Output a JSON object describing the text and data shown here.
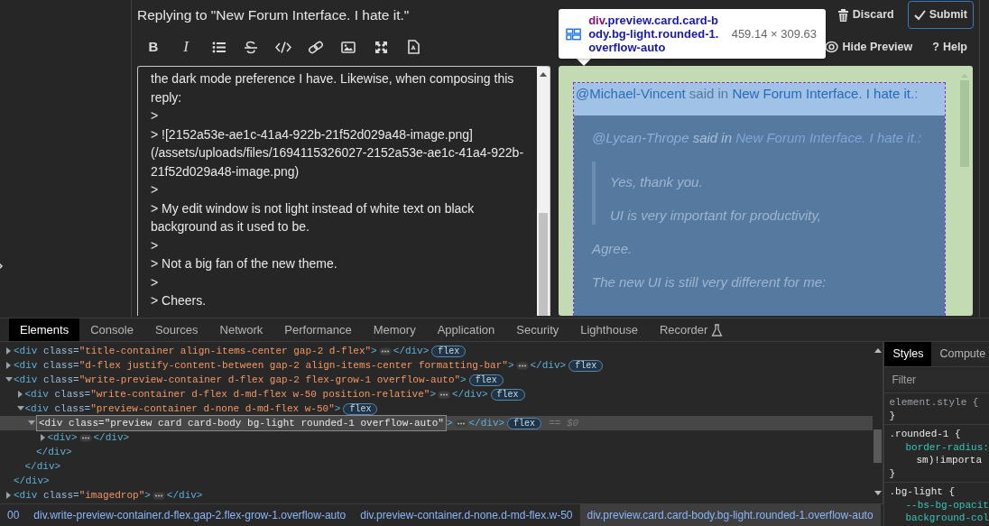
{
  "composer": {
    "title": "Replying to \"New Forum Interface. I hate it.\"",
    "actions": [
      {
        "kind": "discard",
        "label": "Discard"
      },
      {
        "kind": "submit",
        "label": "Submit"
      }
    ],
    "formatting_bar": {
      "bold_glyph": "B",
      "italic_glyph": "I"
    },
    "view_actions": [
      {
        "kind": "preview",
        "label": "Hide Preview"
      },
      {
        "kind": "help",
        "glyph": "?",
        "label": "Help"
      }
    ],
    "editor_lines": [
      "the dark mode preference I have.  Likewise, when composing this",
      "reply:",
      ">",
      "> ![2152a53e-ae1c-41a4-922b-21f52d029a48-image.png]",
      "(/assets/uploads/files/1694115326027-2152a53e-ae1c-41a4-922b-",
      "21f52d029a48-image.png)",
      ">",
      "> My edit window is not light instead of white text on black",
      "background as it used to be.",
      ">",
      "> Not a big fan of the new theme.",
      ">",
      "> Cheers."
    ],
    "preview": {
      "header": {
        "user": "@Michael-Vincent",
        "connector": "said in",
        "topic": "New Forum Interface. I hate it.",
        "suffix": ":"
      },
      "quote_header": {
        "user": "@Lycan-Thrope",
        "connector": "said in",
        "topic": "New Forum Interface. I hate it.:"
      },
      "nested_quote": [
        "Yes, thank you.",
        "UI is very important for productivity,"
      ],
      "paragraphs": [
        "Agree.",
        "The new UI is still very different for me:"
      ]
    }
  },
  "tooltip": {
    "tag": "div",
    "classes": ".preview.card.card-body.bg-light.rounded-1.overflow-auto",
    "size": "459.14 × 309.63"
  },
  "devtools": {
    "tabs": [
      {
        "label": "Elements",
        "selected": true
      },
      {
        "label": "Console",
        "selected": false
      },
      {
        "label": "Sources",
        "selected": false
      },
      {
        "label": "Network",
        "selected": false
      },
      {
        "label": "Performance",
        "selected": false
      },
      {
        "label": "Memory",
        "selected": false
      },
      {
        "label": "Application",
        "selected": false
      },
      {
        "label": "Security",
        "selected": false
      },
      {
        "label": "Lighthouse",
        "selected": false
      },
      {
        "label": "Recorder",
        "selected": false,
        "experimental": true
      }
    ],
    "tree": [
      {
        "expanded": false,
        "selected": false,
        "open": {
          "tag": "<div",
          "attr_name": "class=",
          "attr_value": "\"title-container align-items-center gap-2 d-flex\"",
          "end": ">"
        },
        "ellipsis": true,
        "inline_close": "</div>",
        "badge": "flex"
      },
      {
        "expanded": false,
        "selected": false,
        "open": {
          "tag": "<div",
          "attr_name": "class=",
          "attr_value": "\"d-flex justify-content-between gap-2 align-items-center formatting-bar\"",
          "end": ">"
        },
        "ellipsis": true,
        "inline_close": "</div>",
        "badge": "flex"
      },
      {
        "expanded": true,
        "selected": false,
        "open": {
          "tag": "<div",
          "attr_name": "class=",
          "attr_value": "\"write-preview-container d-flex gap-2 flex-grow-1 overflow-auto\"",
          "end": ">"
        },
        "ellipsis": false,
        "badge": "flex",
        "end_line": "</div>",
        "children": [
          {
            "expanded": false,
            "selected": false,
            "open": {
              "tag": "<div",
              "attr_name": "class=",
              "attr_value": "\"write-container d-flex d-md-flex w-50 position-relative\"",
              "end": ">"
            },
            "ellipsis": true,
            "inline_close": "</div>",
            "badge": "flex"
          },
          {
            "expanded": true,
            "selected": false,
            "open": {
              "tag": "<div",
              "attr_name": "class=",
              "attr_value": "\"preview-container d-none d-md-flex w-50\"",
              "end": ">"
            },
            "ellipsis": false,
            "badge": "flex",
            "end_line": "</div>",
            "children": [
              {
                "expanded": true,
                "selected": true,
                "editing": true,
                "open": {
                  "tag": "<div",
                  "attr_name": "class=",
                  "attr_value": "\"preview card card-body bg-light rounded-1 overflow-auto\"",
                  "end": ">"
                },
                "ellipsis": true,
                "inline_close": "</div>",
                "badge": "flex",
                "marker": "== $0",
                "end_line": "</div>",
                "children": [
                  {
                    "expanded": false,
                    "selected": false,
                    "open": {
                      "tag": "<div",
                      "end": ">"
                    },
                    "ellipsis": true,
                    "inline_close": "</div>"
                  }
                ]
              }
            ]
          }
        ]
      },
      {
        "expanded": false,
        "selected": false,
        "open": {
          "tag": "<div",
          "attr_name": "class=",
          "attr_value": "\"imagedrop\"",
          "end": ">"
        },
        "ellipsis": true,
        "inline_close": "</div>"
      }
    ],
    "breadcrumbs": [
      {
        "label": "00",
        "selected": false
      },
      {
        "label": "div.write-preview-container.d-flex.gap-2.flex-grow-1.overflow-auto",
        "selected": false
      },
      {
        "label": "div.preview-container.d-none.d-md-flex.w-50",
        "selected": false
      },
      {
        "label": "div.preview.card.card-body.bg-light.rounded-1.overflow-auto",
        "selected": true
      }
    ],
    "styles_pane": {
      "tabs": [
        {
          "label": "Styles",
          "selected": true
        },
        {
          "label": "Compute",
          "selected": false
        }
      ],
      "filter": {
        "placeholder": "Filter"
      },
      "rules": [
        [
          {
            "kind": "inline-selector",
            "text": "element.style {"
          },
          {
            "kind": "brace",
            "text": "}"
          }
        ],
        [
          {
            "kind": "selector",
            "text": ".rounded-1 {"
          },
          {
            "kind": "property",
            "text": "border-radius:"
          },
          {
            "kind": "continuation",
            "text": "sm)!importa"
          },
          {
            "kind": "brace",
            "text": "}"
          }
        ],
        [
          {
            "kind": "selector",
            "text": ".bg-light {"
          },
          {
            "kind": "property",
            "text": "--bs-bg-opacit"
          },
          {
            "kind": "property",
            "text": "background-col"
          }
        ]
      ]
    }
  }
}
